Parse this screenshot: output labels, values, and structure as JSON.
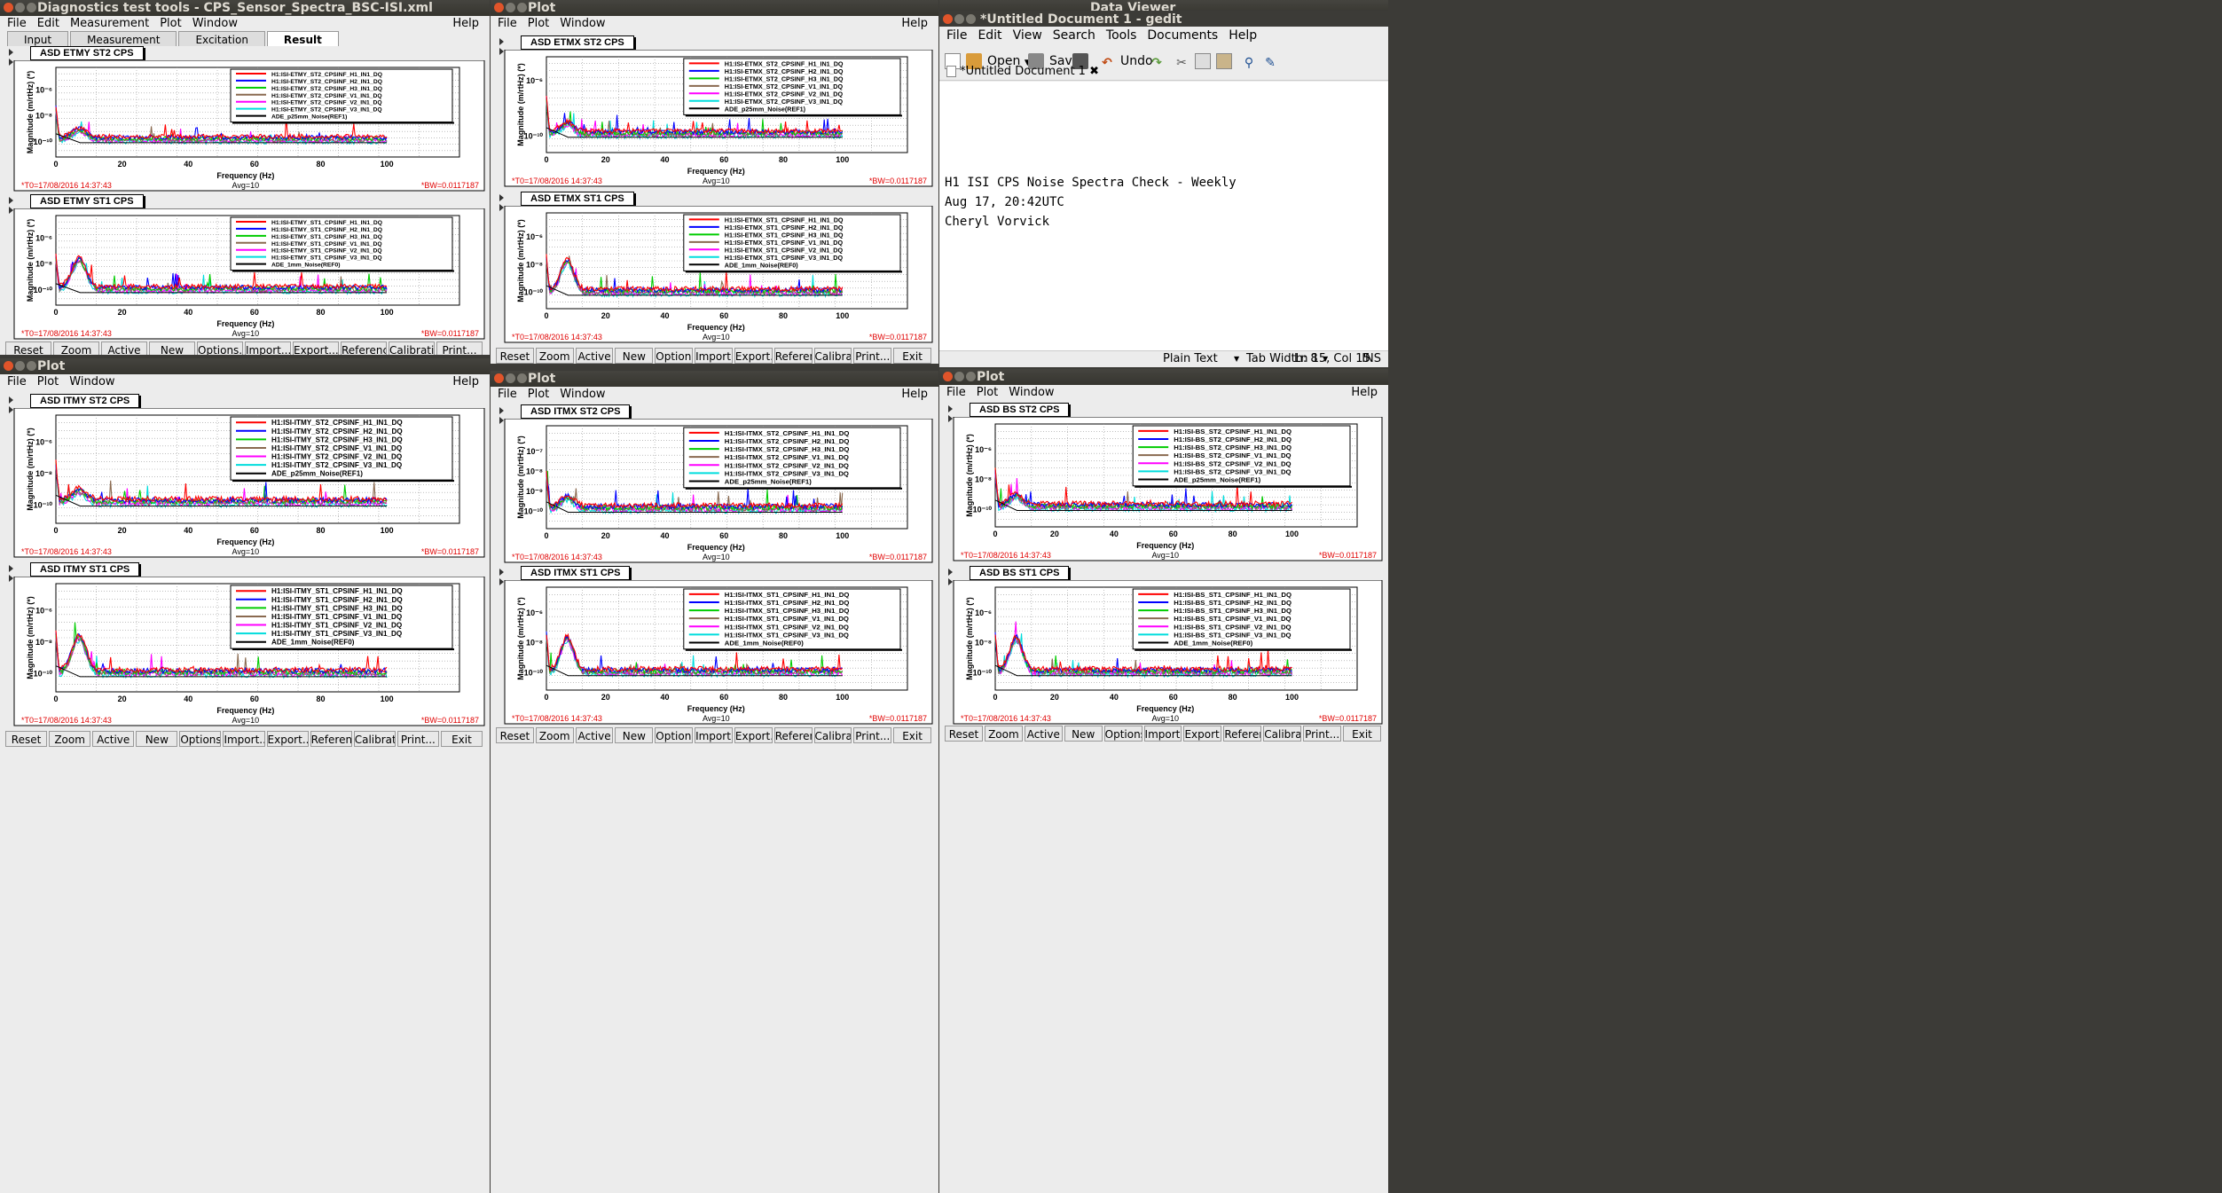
{
  "desktop": {
    "title_diag": "Diagnostics test tools - CPS_Sensor_Spectra_BSC-ISI.xml",
    "title_plot": "Plot",
    "title_dataviewer": "Data Viewer"
  },
  "diag_menu": [
    "File",
    "Edit",
    "Measurement",
    "Plot",
    "Window"
  ],
  "plot_menu": [
    "File",
    "Plot",
    "Window"
  ],
  "help_label": "Help",
  "diag_tabs": [
    "Input",
    "Measurement",
    "Excitation",
    "Result"
  ],
  "active_tab": "Result",
  "buttons": [
    "Reset",
    "Zoom",
    "Active",
    "New",
    "Options...",
    "Import...",
    "Export...",
    "Reference...",
    "Calibration...",
    "Print..."
  ],
  "exit_label": "Exit",
  "common": {
    "ylabel": "Magnitude (m/rtHz) (*)",
    "xlabel": "Frequency (Hz)",
    "t0": "*T0=17/08/2016 14:37:43",
    "avg": "Avg=10",
    "bw": "*BW=0.0117187",
    "xticks": [
      "0",
      "20",
      "40",
      "60",
      "80",
      "100"
    ],
    "series_colors": [
      "#ff0000",
      "#0000ff",
      "#00cc00",
      "#8a6a50",
      "#ff00ff",
      "#00dddd",
      "#000000"
    ]
  },
  "panels": [
    {
      "title": "ASD ETMY ST2 CPS",
      "legend": [
        "H1:ISI-ETMY_ST2_CPSINF_H1_IN1_DQ",
        "H1:ISI-ETMY_ST2_CPSINF_H2_IN1_DQ",
        "H1:ISI-ETMY_ST2_CPSINF_H3_IN1_DQ",
        "H1:ISI-ETMY_ST2_CPSINF_V1_IN1_DQ",
        "H1:ISI-ETMY_ST2_CPSINF_V2_IN1_DQ",
        "H1:ISI-ETMY_ST2_CPSINF_V3_IN1_DQ",
        "ADE_p25mm_Noise(REF1)"
      ],
      "yticks": [
        "10⁻⁶",
        "10⁻⁸",
        "10⁻¹⁰"
      ]
    },
    {
      "title": "ASD ETMY ST1 CPS",
      "legend": [
        "H1:ISI-ETMY_ST1_CPSINF_H1_IN1_DQ",
        "H1:ISI-ETMY_ST1_CPSINF_H2_IN1_DQ",
        "H1:ISI-ETMY_ST1_CPSINF_H3_IN1_DQ",
        "H1:ISI-ETMY_ST1_CPSINF_V1_IN1_DQ",
        "H1:ISI-ETMY_ST1_CPSINF_V2_IN1_DQ",
        "H1:ISI-ETMY_ST1_CPSINF_V3_IN1_DQ",
        "ADE_1mm_Noise(REF0)"
      ],
      "yticks": [
        "10⁻⁶",
        "10⁻⁸",
        "10⁻¹⁰"
      ]
    },
    {
      "title": "ASD ETMX ST2 CPS",
      "legend": [
        "H1:ISI-ETMX_ST2_CPSINF_H1_IN1_DQ",
        "H1:ISI-ETMX_ST2_CPSINF_H2_IN1_DQ",
        "H1:ISI-ETMX_ST2_CPSINF_H3_IN1_DQ",
        "H1:ISI-ETMX_ST2_CPSINF_V1_IN1_DQ",
        "H1:ISI-ETMX_ST2_CPSINF_V2_IN1_DQ",
        "H1:ISI-ETMX_ST2_CPSINF_V3_IN1_DQ",
        "ADE_p25mm_Noise(REF1)"
      ],
      "yticks": [
        "10⁻⁶",
        "10⁻¹⁰"
      ]
    },
    {
      "title": "ASD ETMX ST1 CPS",
      "legend": [
        "H1:ISI-ETMX_ST1_CPSINF_H1_IN1_DQ",
        "H1:ISI-ETMX_ST1_CPSINF_H2_IN1_DQ",
        "H1:ISI-ETMX_ST1_CPSINF_H3_IN1_DQ",
        "H1:ISI-ETMX_ST1_CPSINF_V1_IN1_DQ",
        "H1:ISI-ETMX_ST1_CPSINF_V2_IN1_DQ",
        "H1:ISI-ETMX_ST1_CPSINF_V3_IN1_DQ",
        "ADE_1mm_Noise(REF0)"
      ],
      "yticks": [
        "10⁻⁶",
        "10⁻⁸",
        "10⁻¹⁰"
      ]
    },
    {
      "title": "ASD ITMY ST2 CPS",
      "legend": [
        "H1:ISI-ITMY_ST2_CPSINF_H1_IN1_DQ",
        "H1:ISI-ITMY_ST2_CPSINF_H2_IN1_DQ",
        "H1:ISI-ITMY_ST2_CPSINF_H3_IN1_DQ",
        "H1:ISI-ITMY_ST2_CPSINF_V1_IN1_DQ",
        "H1:ISI-ITMY_ST2_CPSINF_V2_IN1_DQ",
        "H1:ISI-ITMY_ST2_CPSINF_V3_IN1_DQ",
        "ADE_p25mm_Noise(REF1)"
      ],
      "yticks": [
        "10⁻⁶",
        "10⁻⁸",
        "10⁻¹⁰"
      ]
    },
    {
      "title": "ASD ITMY ST1 CPS",
      "legend": [
        "H1:ISI-ITMY_ST1_CPSINF_H1_IN1_DQ",
        "H1:ISI-ITMY_ST1_CPSINF_H2_IN1_DQ",
        "H1:ISI-ITMY_ST1_CPSINF_H3_IN1_DQ",
        "H1:ISI-ITMY_ST1_CPSINF_V1_IN1_DQ",
        "H1:ISI-ITMY_ST1_CPSINF_V2_IN1_DQ",
        "H1:ISI-ITMY_ST1_CPSINF_V3_IN1_DQ",
        "ADE_1mm_Noise(REF0)"
      ],
      "yticks": [
        "10⁻⁶",
        "10⁻⁸",
        "10⁻¹⁰"
      ]
    },
    {
      "title": "ASD ITMX ST2 CPS",
      "legend": [
        "H1:ISI-ITMX_ST2_CPSINF_H1_IN1_DQ",
        "H1:ISI-ITMX_ST2_CPSINF_H2_IN1_DQ",
        "H1:ISI-ITMX_ST2_CPSINF_H3_IN1_DQ",
        "H1:ISI-ITMX_ST2_CPSINF_V1_IN1_DQ",
        "H1:ISI-ITMX_ST2_CPSINF_V2_IN1_DQ",
        "H1:ISI-ITMX_ST2_CPSINF_V3_IN1_DQ",
        "ADE_p25mm_Noise(REF1)"
      ],
      "yticks": [
        "10⁻⁷",
        "10⁻⁸",
        "10⁻⁹",
        "10⁻¹⁰"
      ]
    },
    {
      "title": "ASD ITMX ST1 CPS",
      "legend": [
        "H1:ISI-ITMX_ST1_CPSINF_H1_IN1_DQ",
        "H1:ISI-ITMX_ST1_CPSINF_H2_IN1_DQ",
        "H1:ISI-ITMX_ST1_CPSINF_H3_IN1_DQ",
        "H1:ISI-ITMX_ST1_CPSINF_V1_IN1_DQ",
        "H1:ISI-ITMX_ST1_CPSINF_V2_IN1_DQ",
        "H1:ISI-ITMX_ST1_CPSINF_V3_IN1_DQ",
        "ADE_1mm_Noise(REF0)"
      ],
      "yticks": [
        "10⁻⁶",
        "10⁻⁸",
        "10⁻¹⁰"
      ]
    },
    {
      "title": "ASD BS ST2 CPS",
      "legend": [
        "H1:ISI-BS_ST2_CPSINF_H1_IN1_DQ",
        "H1:ISI-BS_ST2_CPSINF_H2_IN1_DQ",
        "H1:ISI-BS_ST2_CPSINF_H3_IN1_DQ",
        "H1:ISI-BS_ST2_CPSINF_V1_IN1_DQ",
        "H1:ISI-BS_ST2_CPSINF_V2_IN1_DQ",
        "H1:ISI-BS_ST2_CPSINF_V3_IN1_DQ",
        "ADE_p25mm_Noise(REF1)"
      ],
      "yticks": [
        "10⁻⁶",
        "10⁻⁸",
        "10⁻¹⁰"
      ]
    },
    {
      "title": "ASD BS ST1 CPS",
      "legend": [
        "H1:ISI-BS_ST1_CPSINF_H1_IN1_DQ",
        "H1:ISI-BS_ST1_CPSINF_H2_IN1_DQ",
        "H1:ISI-BS_ST1_CPSINF_H3_IN1_DQ",
        "H1:ISI-BS_ST1_CPSINF_V1_IN1_DQ",
        "H1:ISI-BS_ST1_CPSINF_V2_IN1_DQ",
        "H1:ISI-BS_ST1_CPSINF_V3_IN1_DQ",
        "ADE_1mm_Noise(REF0)"
      ],
      "yticks": [
        "10⁻⁶",
        "10⁻⁸",
        "10⁻¹⁰"
      ]
    }
  ],
  "gedit": {
    "title": "*Untitled Document 1 - gedit",
    "menu": [
      "File",
      "Edit",
      "View",
      "Search",
      "Tools",
      "Documents",
      "Help"
    ],
    "toolbar": {
      "open": "Open",
      "save": "Save",
      "undo": "Undo"
    },
    "tab_label": "*Untitled Document 1",
    "lines": [
      "H1 ISI CPS Noise Spectra Check - Weekly",
      "Aug 17, 20:42UTC",
      "Cheryl Vorvick"
    ],
    "status": {
      "lang": "Plain Text",
      "tabwidth": "Tab Width: 8",
      "pos": "Ln 15, Col 15",
      "mode": "INS"
    }
  }
}
